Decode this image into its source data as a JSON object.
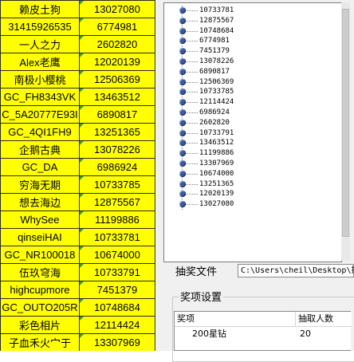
{
  "sheet": {
    "rows": [
      {
        "name": "赖皮土狗",
        "id": "13027080"
      },
      {
        "name": "31415926535",
        "id": "6774981"
      },
      {
        "name": "一人之力",
        "id": "2602820"
      },
      {
        "name": "Alex老鹰",
        "id": "12020139"
      },
      {
        "name": "南极小樱桃",
        "id": "12506369"
      },
      {
        "name": "GC_FH8343VK",
        "id": "13463512"
      },
      {
        "name": "C_5A20777E93I",
        "id": "6890817"
      },
      {
        "name": "GC_4QI1FH9",
        "id": "13251365"
      },
      {
        "name": "企鹅古典",
        "id": "13078226"
      },
      {
        "name": "GC_DA",
        "id": "6986924"
      },
      {
        "name": "穷海无期",
        "id": "10733785"
      },
      {
        "name": "想去海边",
        "id": "12875567"
      },
      {
        "name": "WhySee",
        "id": "11199886"
      },
      {
        "name": "qinseiHAI",
        "id": "10733781"
      },
      {
        "name": "GC_NR100018",
        "id": "10674000"
      },
      {
        "name": "伍玖穹海",
        "id": "10733791"
      },
      {
        "name": "highcupmore",
        "id": "7451379"
      },
      {
        "name": "GC_OUTO205R",
        "id": "10748684"
      },
      {
        "name": "彩色相片",
        "id": "12114424"
      },
      {
        "name": "子血禾火宀于",
        "id": "13307969"
      }
    ]
  },
  "tree": {
    "items": [
      "10733781",
      "12875567",
      "10748684",
      "6774981",
      "7451379",
      "13078226",
      "6890817",
      "12506369",
      "10733785",
      "12114424",
      "6986924",
      "2602820",
      "10733791",
      "13463512",
      "11199886",
      "13307969",
      "10674000",
      "13251365",
      "12020139",
      "13027080"
    ]
  },
  "file": {
    "label": "抽奖文件",
    "path": "C:\\Users\\cheil\\Desktop\\抽"
  },
  "prize": {
    "group_title": "奖项设置",
    "col_prize": "奖项",
    "col_count": "抽取人数",
    "rows": [
      {
        "prize": "200星钻",
        "count": "20"
      }
    ]
  }
}
